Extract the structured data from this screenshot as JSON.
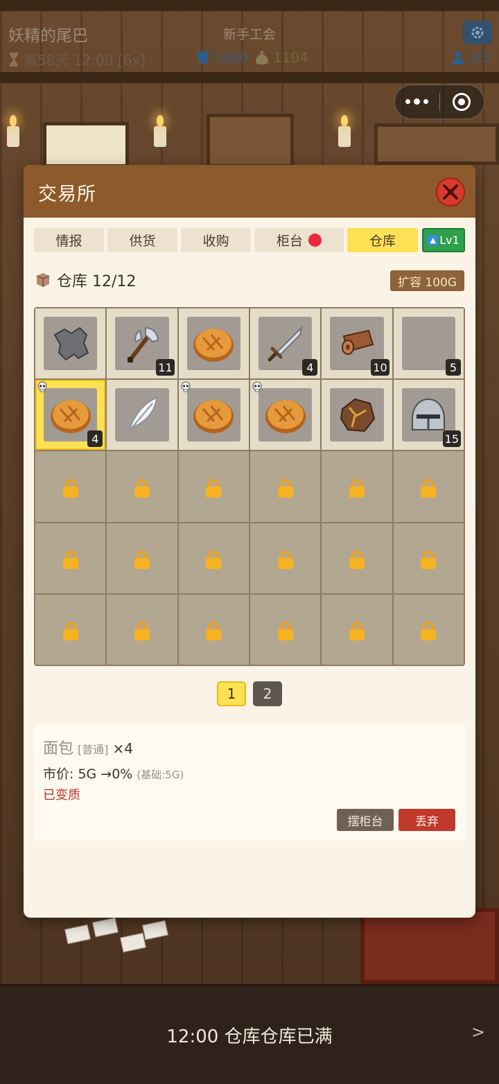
{
  "hud": {
    "guild_name": "妖精的尾巴",
    "guild_rank": "新手工会",
    "day_time": "第58天 12:00 [6x]",
    "shield_value": "1560",
    "money_value": "1104",
    "party": "3/3"
  },
  "modal": {
    "title": "交易所",
    "tabs": [
      "情报",
      "供货",
      "收购",
      "柜台",
      "仓库"
    ],
    "active_tab": "仓库",
    "level_badge": "Lv1",
    "warehouse_label": "仓库 12/12",
    "expand_label": "扩容 100G"
  },
  "inventory": [
    {
      "item": "hide",
      "count": "",
      "spoiled": false,
      "selected": false
    },
    {
      "item": "axe",
      "count": "11",
      "spoiled": false,
      "selected": false
    },
    {
      "item": "bread",
      "count": "",
      "spoiled": false,
      "selected": false
    },
    {
      "item": "sword",
      "count": "4",
      "spoiled": false,
      "selected": false
    },
    {
      "item": "leather-roll",
      "count": "10",
      "spoiled": false,
      "selected": false
    },
    {
      "item": "empty",
      "count": "5",
      "spoiled": false,
      "selected": false
    },
    {
      "item": "bread",
      "count": "4",
      "spoiled": true,
      "selected": true
    },
    {
      "item": "feather",
      "count": "",
      "spoiled": false,
      "selected": false
    },
    {
      "item": "bread",
      "count": "",
      "spoiled": true,
      "selected": false
    },
    {
      "item": "bread",
      "count": "",
      "spoiled": true,
      "selected": false
    },
    {
      "item": "ore",
      "count": "",
      "spoiled": false,
      "selected": false
    },
    {
      "item": "helmet",
      "count": "15",
      "spoiled": false,
      "selected": false
    }
  ],
  "locked_slots": 18,
  "pager": {
    "pages": [
      "1",
      "2"
    ],
    "current": "1"
  },
  "detail": {
    "name": "面包",
    "rarity": "[普通]",
    "quantity": "×4",
    "price": "市价: 5G →0%",
    "price_base": "(基础:5G)",
    "status": "已变质",
    "shelf_button": "摆柜台",
    "discard_button": "丢弃"
  },
  "bottom": {
    "message": "12:00 仓库仓库已满",
    "arrow": ">"
  },
  "colors": {
    "header_brown": "#8d5a2b",
    "active_tab": "#fde154",
    "close_red": "#d93a2c",
    "level_green": "#2ea04c",
    "spoiled_text": "#c62f2a",
    "discard_red": "#c0392b"
  }
}
